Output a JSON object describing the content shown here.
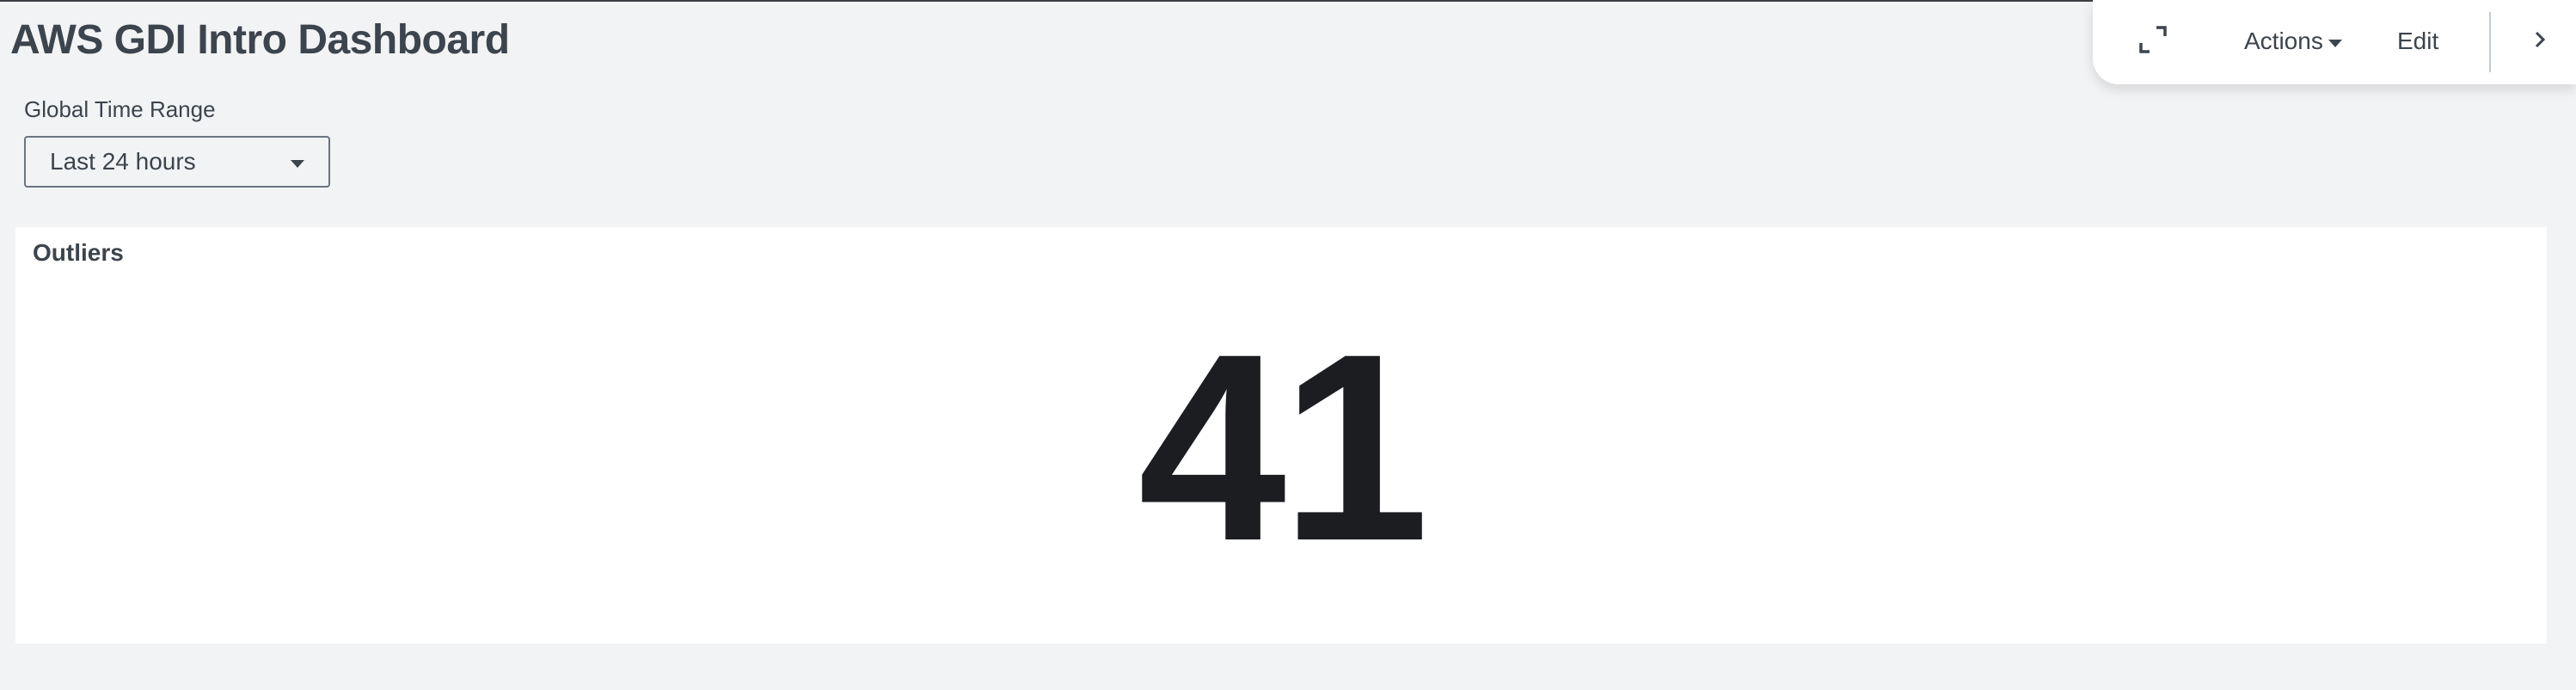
{
  "dashboard": {
    "title": "AWS GDI Intro Dashboard"
  },
  "toolbar": {
    "expand_icon": "fullscreen-icon",
    "actions_label": "Actions",
    "edit_label": "Edit",
    "next_icon": "chevron-right-icon"
  },
  "time_range": {
    "label": "Global Time Range",
    "selected": "Last 24 hours"
  },
  "panels": [
    {
      "title": "Outliers",
      "value": "41"
    }
  ],
  "colors": {
    "background": "#f2f3f5",
    "panel": "#ffffff",
    "text": "#3c444d",
    "value": "#1b1d20"
  }
}
